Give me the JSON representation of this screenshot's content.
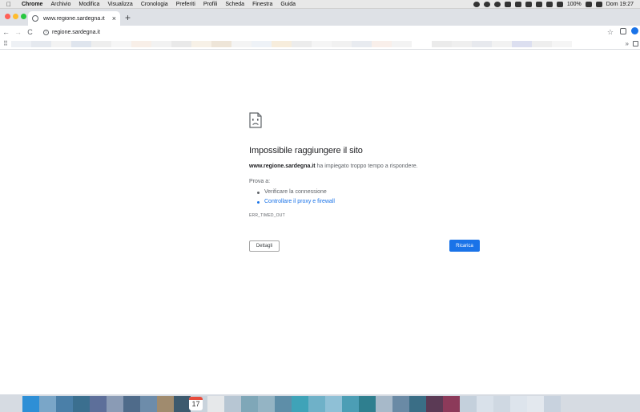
{
  "menubar": {
    "app": "Chrome",
    "items": [
      "Archivio",
      "Modifica",
      "Visualizza",
      "Cronologia",
      "Preferiti",
      "Profili",
      "Scheda",
      "Finestra",
      "Guida"
    ],
    "battery": "100%",
    "clock": "Dom 19:27"
  },
  "tab": {
    "title": "www.regione.sardegna.it",
    "close_glyph": "×",
    "new_tab_glyph": "+"
  },
  "toolbar": {
    "back_glyph": "←",
    "forward_glyph": "→",
    "reload_glyph": "C",
    "url": "regione.sardegna.it",
    "star_glyph": "☆"
  },
  "bookmarks": {
    "more_glyph": "»",
    "tile_colors": [
      "#eef1f5",
      "#e5e9ef",
      "#f3f3f3",
      "#dfe5ee",
      "#eeeeee",
      "#f6f6f6",
      "#f8efe8",
      "#f2f2f2",
      "#e9e9e9",
      "#f7f1e7",
      "#eee5d8",
      "#f4f4f4",
      "#eef2f7",
      "#f7eddc",
      "#ececec",
      "#f5f5f5",
      "#f1f1f1",
      "#e8ebf0",
      "#f9efea",
      "#f3f3f3",
      "#ffffff",
      "#ebebeb",
      "#efefef",
      "#e7e9ee",
      "#f2f2f2",
      "#dcdff0",
      "#eeeeee",
      "#f5f5f5"
    ]
  },
  "error": {
    "title": "Impossibile raggiungere il sito",
    "host": "www.regione.sardegna.it",
    "message": " ha impiegato troppo tempo a rispondere.",
    "suggestions_heading": "Prova a:",
    "suggestions": [
      "Verificare la connessione",
      "Controllare il proxy e firewall"
    ],
    "code": "ERR_TIMED_OUT",
    "details_label": "Dettagli",
    "reload_label": "Ricarica"
  },
  "dock": {
    "calendar_day": "17",
    "tile_colors": [
      "#2e8fd6",
      "#7aa6c8",
      "#4a7fa8",
      "#3b6f8f",
      "#5d6f9a",
      "#8a9bb5",
      "#4f6b8a",
      "#6d8caa",
      "#a08b6e",
      "#3d5a6e",
      "#c9d3dc",
      "#e6e8ea",
      "#b7c6d3",
      "#7fa7b8",
      "#94b4c4",
      "#5e8ea8",
      "#3fa3b8",
      "#6fb1c8",
      "#8fc0d6",
      "#4c9eb5",
      "#2f7f8f",
      "#a7b9c9",
      "#6a8aa5",
      "#3a6e86",
      "#5b3a55",
      "#8c3a5a",
      "#c4d0dc",
      "#d9e1ea",
      "#cfd8e2",
      "#dde4ec",
      "#e3e8ee",
      "#c8d2de"
    ]
  },
  "colors": {
    "accent": "#1a73e8",
    "traffic_red": "#ff5f57",
    "traffic_yellow": "#febc2e",
    "traffic_green": "#28c840"
  }
}
